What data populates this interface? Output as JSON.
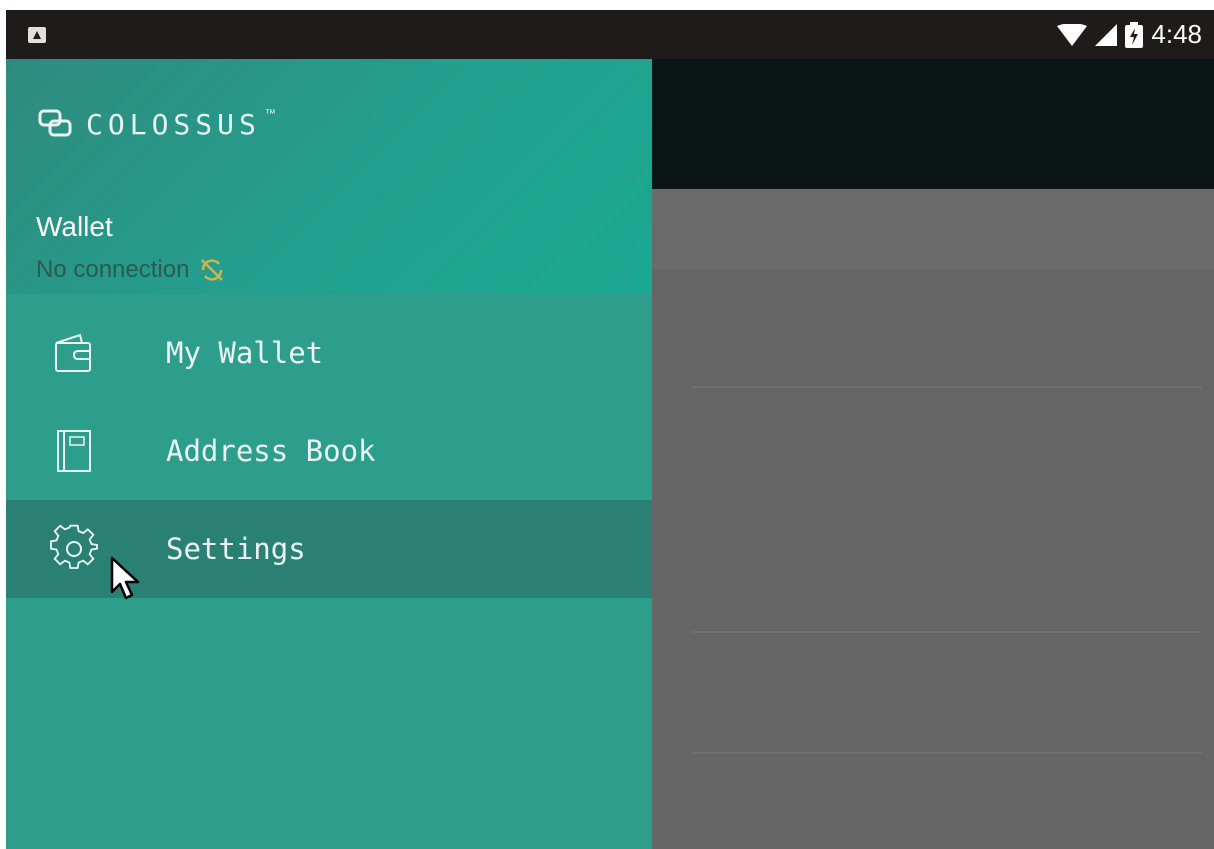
{
  "status_bar": {
    "time": "4:48",
    "notification_icon": "app-notification-icon",
    "wifi_icon": "wifi-icon",
    "signal_icon": "cell-signal-icon",
    "battery_icon": "battery-charging-icon"
  },
  "drawer": {
    "brand": {
      "logo_icon": "colossus-logo-icon",
      "name": "COLOSSUS",
      "trademark": "™"
    },
    "wallet": {
      "title": "Wallet",
      "connection_status": "No connection",
      "connection_icon": "sync-off-icon"
    },
    "items": [
      {
        "label": "My Wallet",
        "icon": "wallet-icon",
        "active": false
      },
      {
        "label": "Address Book",
        "icon": "address-book-icon",
        "active": false
      },
      {
        "label": "Settings",
        "icon": "gear-icon",
        "active": true
      }
    ]
  },
  "colors": {
    "drawer_bg": "#2e9e8c",
    "drawer_active": "#2a8073",
    "status_bar": "#1e1b1a",
    "toolbar": "#0b1516",
    "scrim": "#666666",
    "warning": "#d4b24a"
  }
}
